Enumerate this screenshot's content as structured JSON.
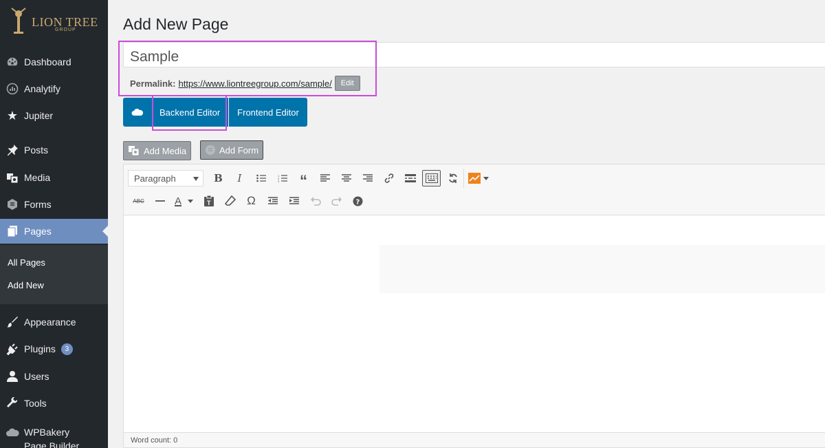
{
  "sidebar": {
    "logo_text": "LION TREE",
    "logo_sub": "GROUP",
    "items": [
      {
        "label": "Dashboard",
        "icon": "dashboard-icon"
      },
      {
        "label": "Analytify",
        "icon": "analytics-icon"
      },
      {
        "label": "Jupiter",
        "icon": "star-icon"
      },
      {
        "label": "Posts",
        "icon": "pin-icon"
      },
      {
        "label": "Media",
        "icon": "media-icon"
      },
      {
        "label": "Forms",
        "icon": "forms-icon"
      },
      {
        "label": "Pages",
        "icon": "pages-icon"
      },
      {
        "label": "Appearance",
        "icon": "brush-icon"
      },
      {
        "label": "Plugins",
        "icon": "plug-icon",
        "badge": "3"
      },
      {
        "label": "Users",
        "icon": "user-icon"
      },
      {
        "label": "Tools",
        "icon": "wrench-icon"
      },
      {
        "label": "WPBakery Page Builder",
        "icon": "cloud-icon"
      }
    ],
    "submenu": [
      "All Pages",
      "Add New"
    ],
    "active_color": "#6f8ec0"
  },
  "page": {
    "title": "Add New Page",
    "post_title": "Sample",
    "permalink_label": "Permalink:",
    "permalink_url": "https://www.liontreegroup.com/sample/",
    "edit_label": "Edit"
  },
  "builder": {
    "backend_label": "Backend Editor",
    "frontend_label": "Frontend Editor"
  },
  "media": {
    "add_media": "Add Media",
    "add_form": "Add Form"
  },
  "editor": {
    "format_select": "Paragraph",
    "word_count": "Word count: 0"
  },
  "highlight_color": "#c94dd8"
}
